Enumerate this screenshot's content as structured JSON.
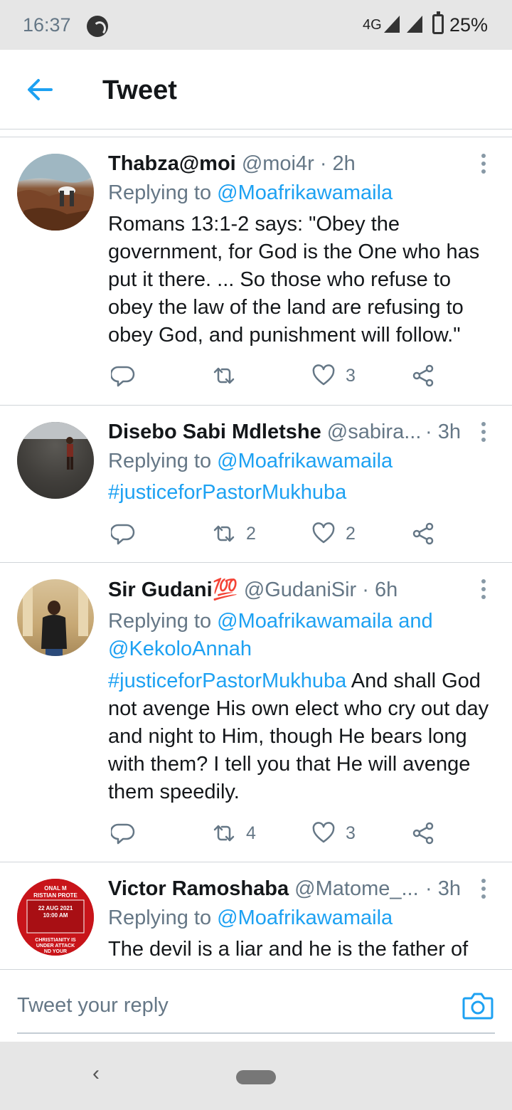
{
  "status_bar": {
    "time": "16:37",
    "network": "4G",
    "battery": "25%"
  },
  "header": {
    "title": "Tweet"
  },
  "tweets": [
    {
      "name": "Thabza@moi",
      "handle": "@moi4r",
      "time": "· 2h",
      "replying_prefix": "Replying to ",
      "replying_to": "@Moafrikawamaila",
      "text": "Romans 13:1-2 says: \"Obey the government, for God is the One who has put it there. ... So those who refuse to obey the law of the land are refusing to obey God, and punishment will follow.\"",
      "likes": "3"
    },
    {
      "name": "Disebo Sabi Mdletshe",
      "handle": "@sabira...",
      "time": "· 3h",
      "replying_prefix": "Replying to ",
      "replying_to": "@Moafrikawamaila",
      "hashtag": "#justiceforPastorMukhuba",
      "retweets": "2",
      "likes": "2"
    },
    {
      "name": "Sir Gudani💯",
      "handle": "@GudaniSir",
      "time": "· 6h",
      "replying_prefix": "Replying to ",
      "replying_to": "@Moafrikawamaila and",
      "replying_to_2": "@KekoloAnnah",
      "hashtag": "#justiceforPastorMukhuba",
      "text": " And shall God not avenge His own elect who cry out day and night to Him, though He bears long with them? I tell you that He will avenge them speedily.",
      "retweets": "4",
      "likes": "3"
    },
    {
      "name": "Victor Ramoshaba",
      "handle": "@Matome_...",
      "time": "· 3h",
      "replying_prefix": "Replying to ",
      "replying_to": "@Moafrikawamaila",
      "text": "The devil is a liar and he is the father of",
      "avatar_text": [
        "ONAL M",
        "RISTIAN PROTE",
        "22 AUG 2021",
        "10:00 AM",
        "CHRISTIANITY IS",
        "UNDER ATTACK",
        "ND YOUR"
      ]
    }
  ],
  "composer": {
    "placeholder": "Tweet your reply"
  },
  "colors": {
    "accent": "#1da1f2",
    "muted": "#657786"
  },
  "icons": [
    "back-arrow-icon",
    "more-vertical-icon",
    "reply-icon",
    "retweet-icon",
    "heart-icon",
    "share-icon",
    "camera-icon",
    "nav-back-icon",
    "home-pill-icon"
  ]
}
